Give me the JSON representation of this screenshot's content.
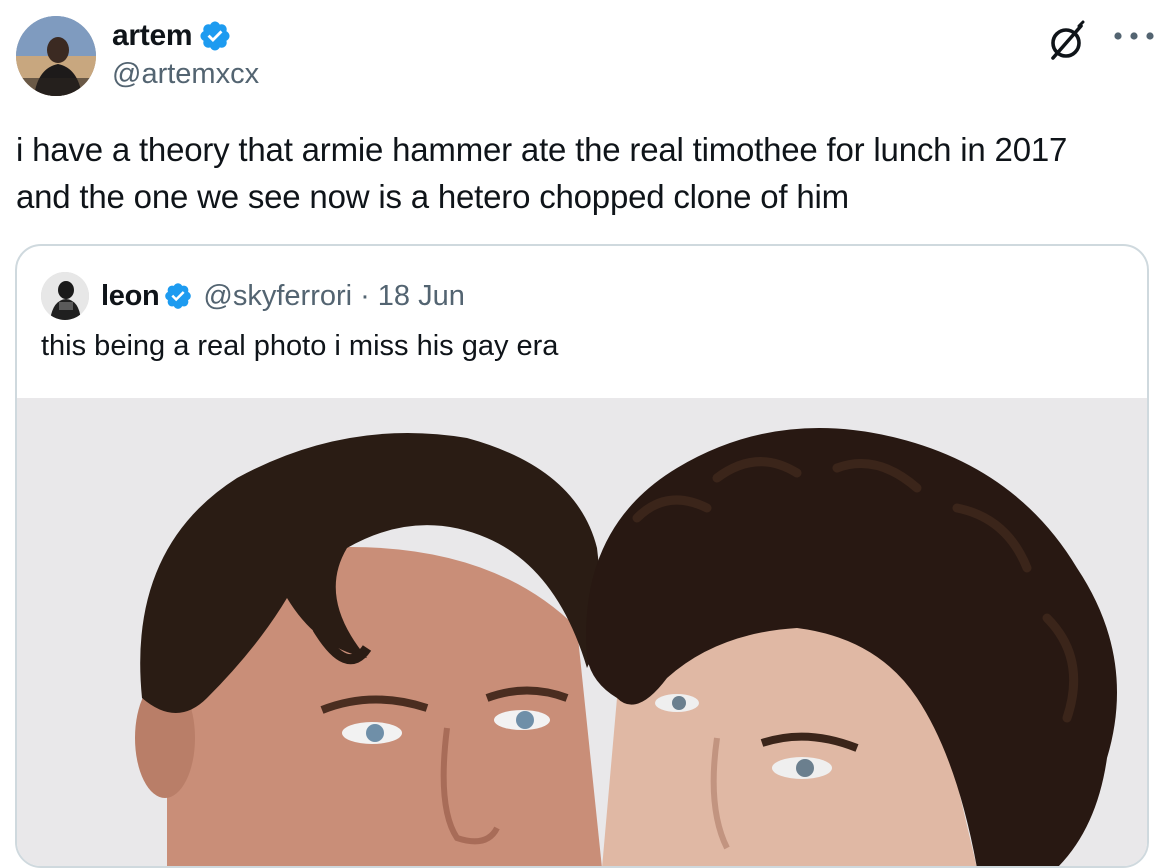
{
  "author": {
    "display_name": "artem",
    "handle": "@artemxcx",
    "verified": true,
    "avatar_icon": "user-avatar-photo"
  },
  "actions": {
    "grok_icon": "grok-icon",
    "more_icon": "more-dots-icon"
  },
  "tweet": {
    "lines": [
      "i have a theory that armie hammer ate the real timothee for lunch in 2017",
      "and the one we see now is a hetero chopped clone of him"
    ]
  },
  "quote": {
    "display_name": "leon",
    "handle": "@skyferrori",
    "separator": "·",
    "date": "18 Jun",
    "verified": true,
    "text": "this being a real photo i miss his gay era",
    "media_icon": "photo-two-people"
  },
  "colors": {
    "text_primary": "#0f1419",
    "text_secondary": "#536471",
    "verified_blue": "#1d9bf0",
    "border": "#cfd9de"
  }
}
